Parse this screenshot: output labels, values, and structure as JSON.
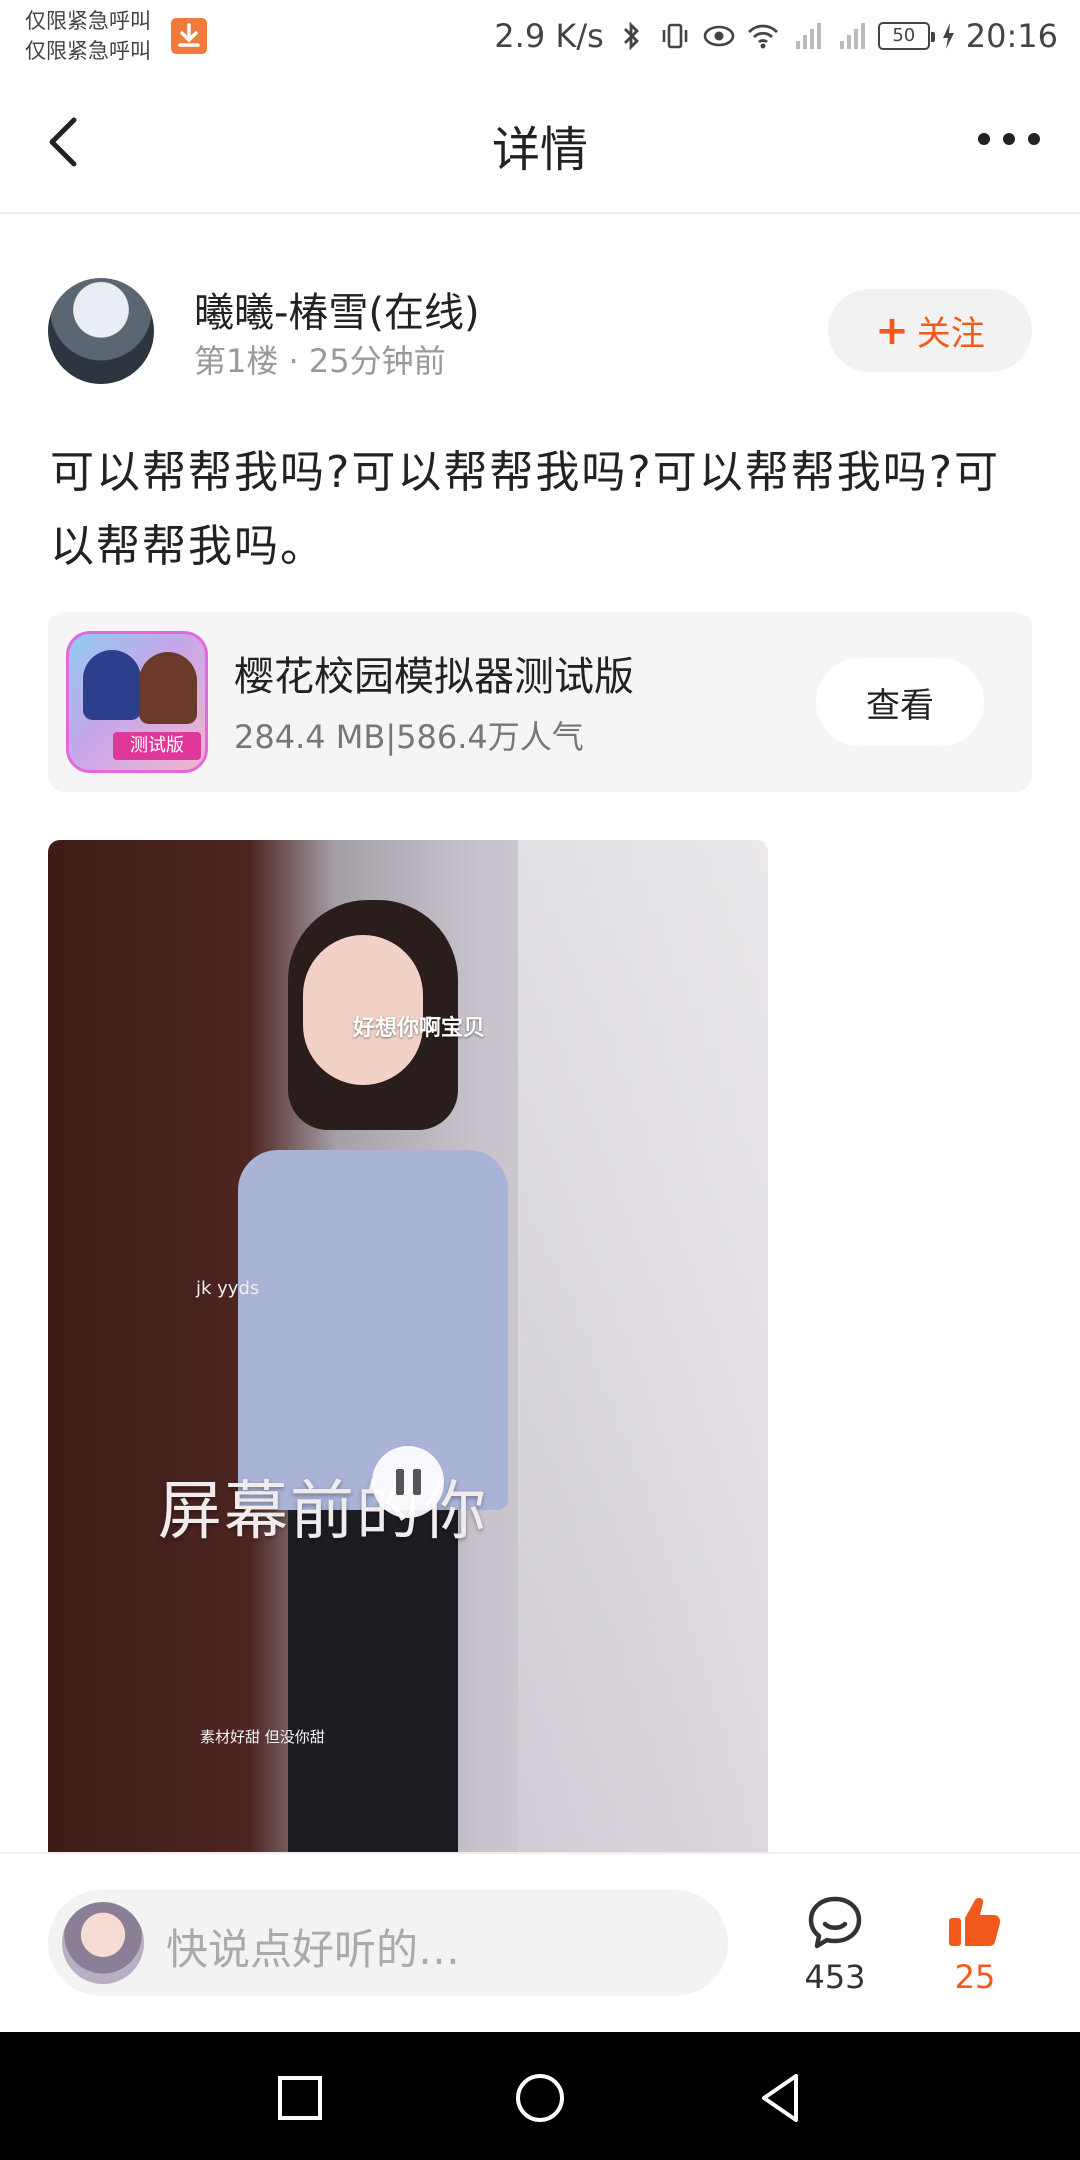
{
  "status_bar": {
    "carrier_line1": "仅限紧急呼叫",
    "carrier_line2": "仅限紧急呼叫",
    "net_speed": "2.9 K/s",
    "battery": "50",
    "time": "20:16"
  },
  "header": {
    "title": "详情"
  },
  "author": {
    "name": "曦曦-椿雪(在线)",
    "floor": "第1楼",
    "time_ago": "25分钟前",
    "follow_label": "关注"
  },
  "post": {
    "text": "可以帮帮我吗?可以帮帮我吗?可以帮帮我吗?可以帮帮我吗。"
  },
  "app_card": {
    "name": "樱花校园模拟器测试版",
    "size": "284.4 MB",
    "popularity": "586.4万人气",
    "icon_badge": "测试版",
    "view_label": "查看"
  },
  "video": {
    "caption_top": "好想你啊宝贝",
    "caption_side": "jk yyds",
    "caption_main": "屏幕前的你",
    "caption_bottom": "素材好甜 但没你甜"
  },
  "bottom_bar": {
    "placeholder": "快说点好听的…",
    "comment_count": "453",
    "like_count": "25"
  },
  "colors": {
    "accent": "#f25a1c",
    "muted": "#999999"
  },
  "icons": {
    "back": "back-arrow-icon",
    "more": "more-dots-icon",
    "comment": "comment-bubble-icon",
    "like": "thumbs-up-icon"
  }
}
